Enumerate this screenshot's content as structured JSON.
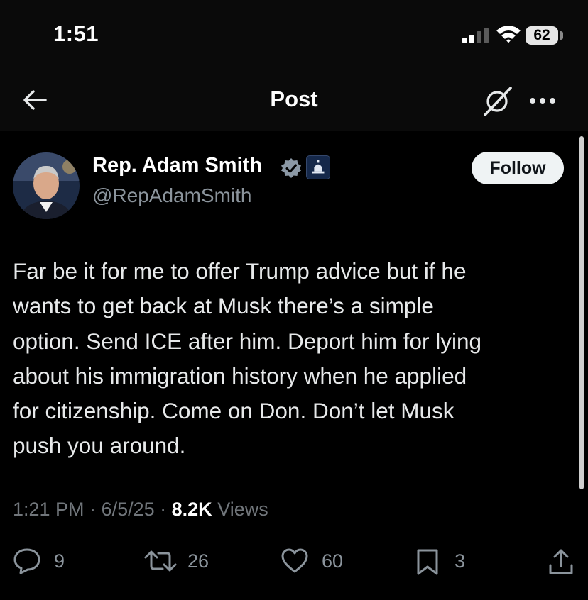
{
  "status_bar": {
    "time": "1:51",
    "battery": "62"
  },
  "nav": {
    "title": "Post",
    "icons": [
      "back-arrow-icon",
      "grok-icon",
      "more-icon"
    ]
  },
  "author": {
    "name": "Rep. Adam Smith",
    "handle": "@RepAdamSmith",
    "verified_color": "#8b98a5",
    "affiliation_badge": "capitol-dome-icon"
  },
  "follow_label": "Follow",
  "post": {
    "lines": [
      "Far be it for me to offer Trump advice but if he",
      "wants to get back at Musk there’s a simple",
      "option. Send ICE after him. Deport him for lying",
      "about his immigration history when he applied",
      "for citizenship. Come on Don. Don’t let Musk",
      "push you around."
    ]
  },
  "meta": {
    "time": "1:21 PM",
    "date": "6/5/25",
    "views_count": "8.2K",
    "views_label": "Views"
  },
  "actions": {
    "replies": "9",
    "reposts": "26",
    "likes": "60",
    "bookmarks": "3"
  },
  "colors": {
    "background": "#000000",
    "text": "#e7e9ea",
    "secondary": "#71767b"
  }
}
